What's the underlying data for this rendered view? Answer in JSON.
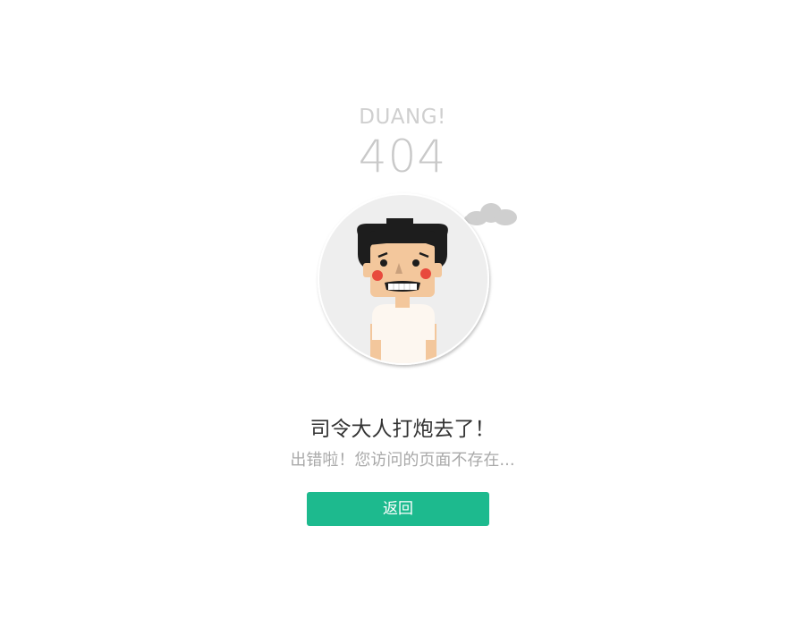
{
  "error": {
    "eyebrow": "DUANG!",
    "code": "404",
    "headline": "司令大人打炮去了！",
    "message": "出错啦！您访问的页面不存在..."
  },
  "actions": {
    "back_label": "返回"
  },
  "illustration": {
    "subject": "cartoon-man-icon",
    "cloud": "cloud-icon"
  },
  "colors": {
    "accent": "#1dba8e",
    "muted_text": "#c9c9c9",
    "headline_text": "#333333",
    "sub_text": "#a9a9a9",
    "avatar_bg": "#eeeeee"
  }
}
